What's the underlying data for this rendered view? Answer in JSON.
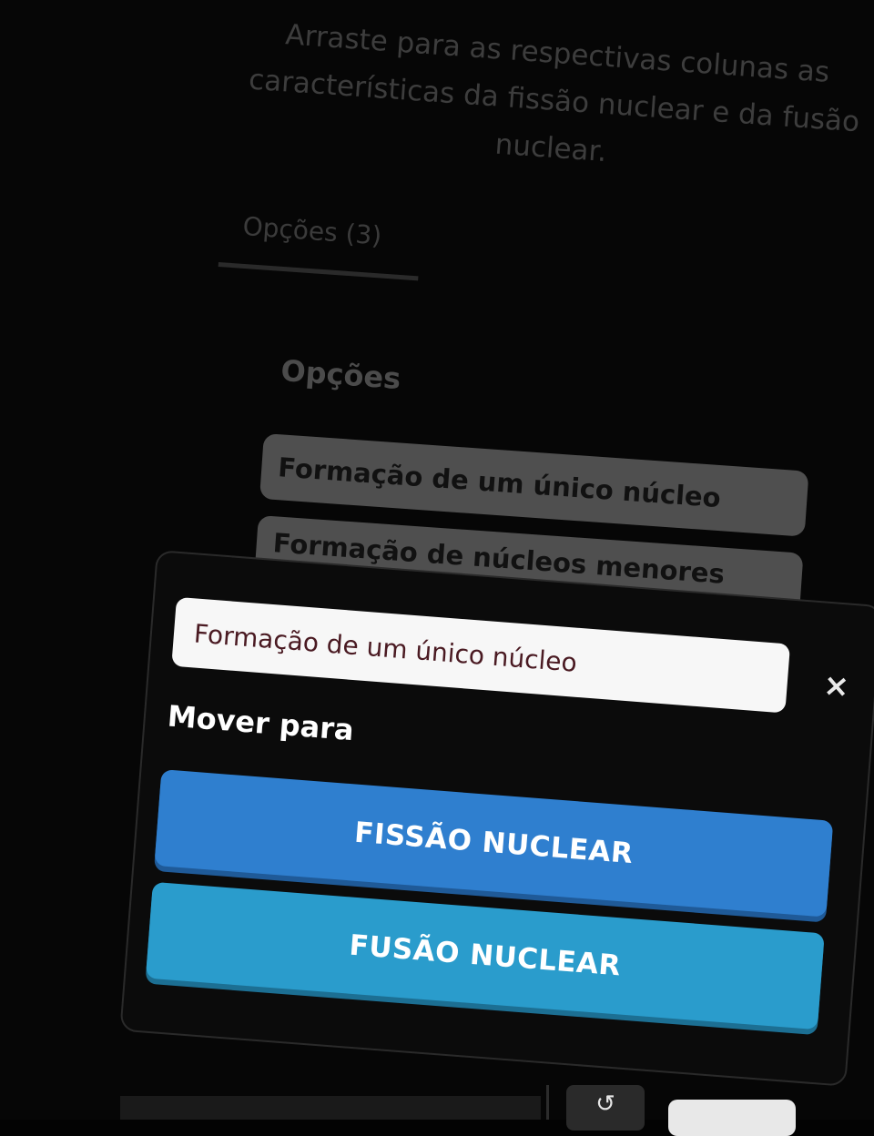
{
  "instruction": "Arraste para as respectivas colunas as características da fissão nuclear e da fusão nuclear.",
  "tabs": {
    "options_label": "Opções (3)"
  },
  "options_panel": {
    "heading": "Opções",
    "items": [
      "Formação de um único núcleo",
      "Formação de núcleos menores"
    ]
  },
  "modal": {
    "selected_item": "Formação de um único núcleo",
    "close_icon": "×",
    "move_label": "Mover para",
    "destinations": [
      "FISSÃO NUCLEAR",
      "FUSÃO NUCLEAR"
    ],
    "colors": {
      "fission": "#2f7fcf",
      "fusion": "#2a9ccc"
    }
  },
  "toolbar": {
    "undo_icon": "↺"
  }
}
